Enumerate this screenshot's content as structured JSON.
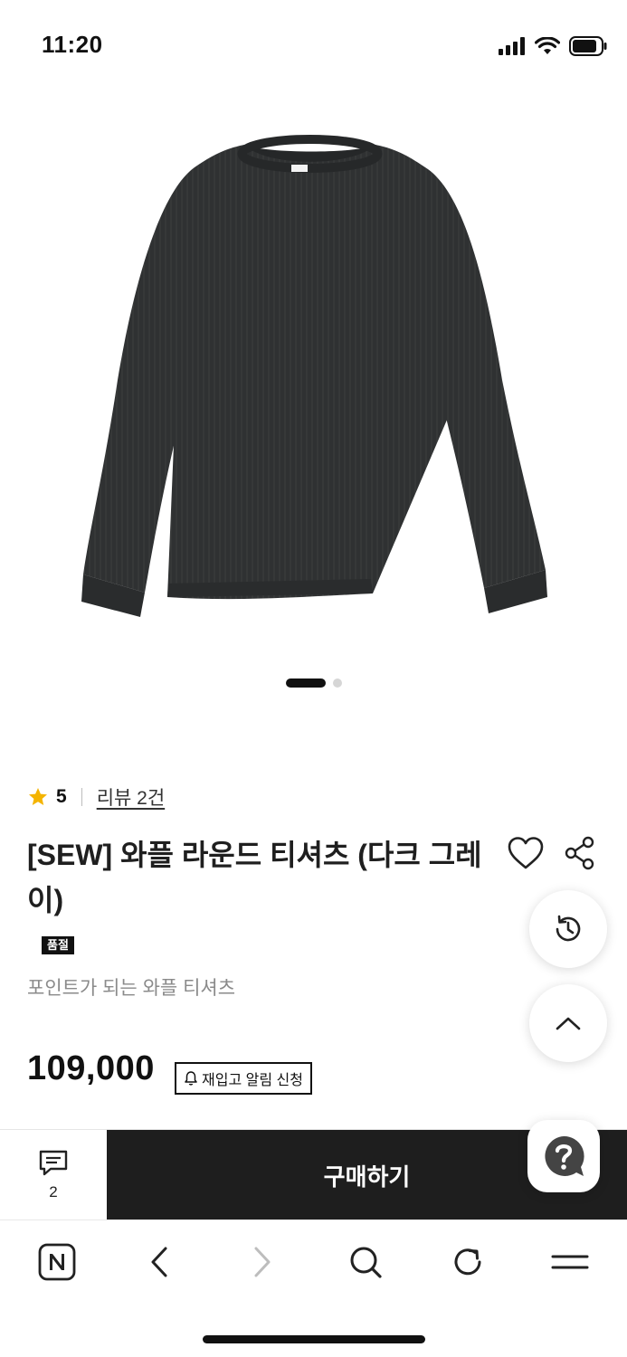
{
  "status_bar": {
    "time": "11:20"
  },
  "product": {
    "rating": "5",
    "review_link": "리뷰 2건",
    "title": "[SEW] 와플 라운드 티셔츠 (다크 그레이)",
    "soldout_badge": "품절",
    "subtitle": "포인트가 되는 와플 티셔츠",
    "price": "109,000",
    "restock_label": "재입고 알림 신청",
    "image_color": "#2f3132"
  },
  "carousel": {
    "total": 2,
    "active": 1
  },
  "purchase_bar": {
    "chat_count": "2",
    "buy_label": "구매하기"
  },
  "colors": {
    "accent_star": "#f4b400",
    "dark_button": "#1e1e1e"
  },
  "icons": {
    "rating": "star-icon",
    "wishlist": "heart-icon",
    "share": "share-icon",
    "history": "history-icon",
    "scroll_top": "chevron-up-icon",
    "help": "help-icon",
    "chat": "chat-icon",
    "browser_home": "naver-home-icon",
    "browser_back": "back-icon",
    "browser_forward": "forward-icon",
    "browser_search": "search-icon",
    "browser_refresh": "refresh-icon",
    "browser_menu": "menu-icon"
  }
}
